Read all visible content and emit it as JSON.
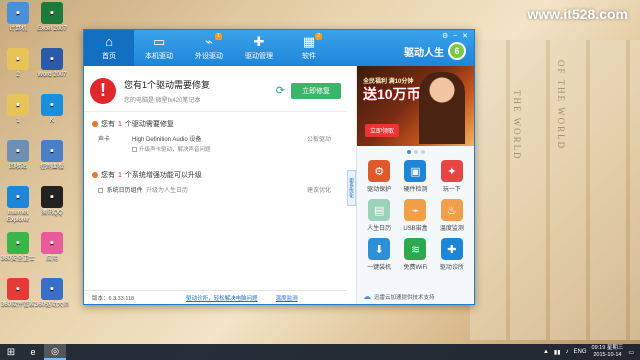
{
  "watermark": "www.it528.com",
  "desktop_icons": [
    {
      "label": "计算机",
      "icon": "computer-icon",
      "color": "#4a90d9"
    },
    {
      "label": "Excel 2007",
      "icon": "excel-icon",
      "color": "#1d7a3a"
    },
    {
      "label": "2",
      "icon": "folder-icon",
      "color": "#e8c35a"
    },
    {
      "label": "Word 2007",
      "icon": "word-icon",
      "color": "#2b5aa8"
    },
    {
      "label": "1",
      "icon": "folder-icon",
      "color": "#e8c35a"
    },
    {
      "label": "K",
      "icon": "k-app-icon",
      "color": "#1a8fe0"
    },
    {
      "label": "回收站",
      "icon": "recycle-bin-icon",
      "color": "#6d8fb3"
    },
    {
      "label": "控制面板",
      "icon": "control-panel-icon",
      "color": "#4a7fc7"
    },
    {
      "label": "Internet Explorer",
      "icon": "ie-icon",
      "color": "#1e86d8"
    },
    {
      "label": "腾讯QQ",
      "icon": "qq-icon",
      "color": "#222222"
    },
    {
      "label": "360安全卫士",
      "icon": "360-security-icon",
      "color": "#39b54a"
    },
    {
      "label": "应用",
      "icon": "pinwheel-icon",
      "color": "#e95b9b"
    },
    {
      "label": "360软件管家",
      "icon": "360-software-icon",
      "color": "#e43a3a"
    },
    {
      "label": "360驱动大师",
      "icon": "gear-app-icon",
      "color": "#3a6fc7"
    }
  ],
  "app": {
    "nav": [
      {
        "label": "首页",
        "icon": "home-icon",
        "active": true,
        "badge": ""
      },
      {
        "label": "本机驱动",
        "icon": "monitor-icon",
        "active": false,
        "badge": ""
      },
      {
        "label": "外设驱动",
        "icon": "usb-icon",
        "active": false,
        "badge": "1"
      },
      {
        "label": "驱动管理",
        "icon": "wrench-icon",
        "active": false,
        "badge": ""
      },
      {
        "label": "软件",
        "icon": "apps-icon",
        "active": false,
        "badge": "2"
      }
    ],
    "brand": "驱动人生",
    "brand_logo_text": "6",
    "alert": {
      "title": "您有1个驱动需要修复",
      "subtitle": "您的电脑是:微星fx420笔记本",
      "fix_button": "立即修复"
    },
    "section1": {
      "prefix": "您有",
      "count": "1",
      "suffix": "个驱动需要修复",
      "row": {
        "category": "声卡",
        "device": "High Definition Audio 设备",
        "option": "升级声卡驱动，解决声音问题",
        "status": "公板驱动"
      }
    },
    "section2": {
      "prefix": "您有",
      "count": "1",
      "suffix": "个系统增强功能可以升级",
      "row": {
        "name": "系统日历组件",
        "desc": "升级为人生日历",
        "status": "建议优化"
      }
    },
    "side_tab": "更多优化",
    "footer": {
      "version": "版本：6.3.33.118",
      "link1": "驱动诊所，轻松解决电脑问题",
      "link2": "温度监测"
    },
    "ad": {
      "line1": "全民福利 满10分钟",
      "line2": "送10万币",
      "button": "立即领取"
    },
    "tools": [
      {
        "label": "驱动保护",
        "icon": "shield-gear-icon",
        "color": "#e0592a"
      },
      {
        "label": "硬件检测",
        "icon": "monitor-check-icon",
        "color": "#1e86d8"
      },
      {
        "label": "玩一下",
        "icon": "gamepad-icon",
        "color": "#e64545"
      },
      {
        "label": "人生日历",
        "icon": "calendar-icon",
        "color": "#9ad3b9"
      },
      {
        "label": "USB宙盒",
        "icon": "usb-box-icon",
        "color": "#f0a04b"
      },
      {
        "label": "温度监测",
        "icon": "thermometer-icon",
        "color": "#f0a04b"
      },
      {
        "label": "一键装机",
        "icon": "install-icon",
        "color": "#2d8fd5"
      },
      {
        "label": "免费WiFi",
        "icon": "wifi-icon",
        "color": "#2fa84f"
      },
      {
        "label": "驱动诊所",
        "icon": "clinic-icon",
        "color": "#1e86d8"
      }
    ],
    "cloud_text": "迅雷云加速提供技术支持"
  },
  "taskbar": {
    "lang": "ENG",
    "time": "09:19 星期三",
    "date": "2015-10-14"
  }
}
